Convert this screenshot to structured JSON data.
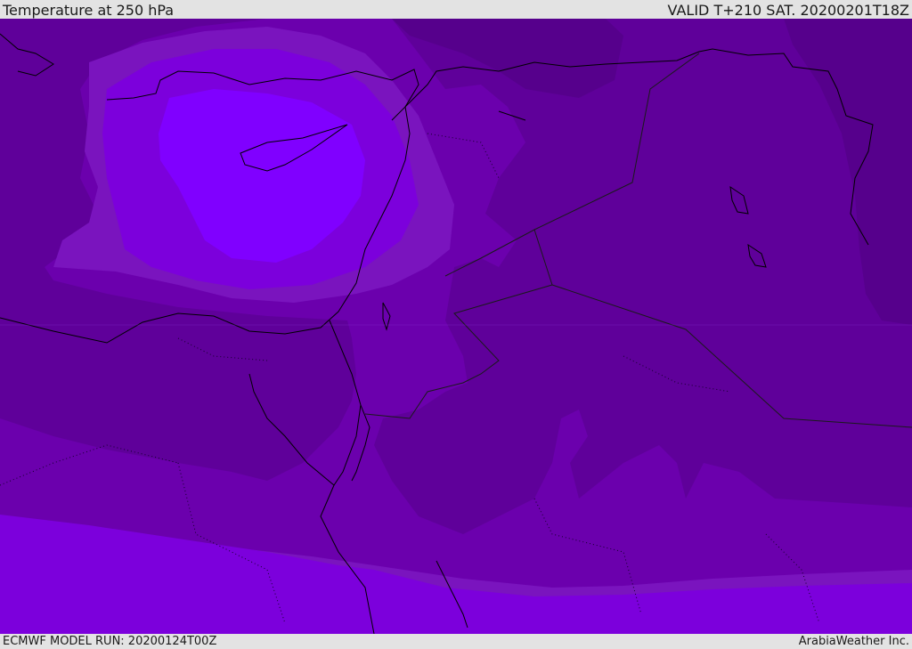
{
  "map": {
    "title": "Temperature at 250 hPa",
    "valid_time": "VALID T+210 SAT. 20200201T18Z",
    "model_run": "ECMWF MODEL RUN: 20200124T00Z",
    "credit": "ArabiaWeather Inc.",
    "colors": {
      "band_coldest_dark": "#56008c",
      "band_dark": "#5f009a",
      "band_mid": "#6b00ad",
      "band_light": "#7a14be",
      "band_bright": "#7c00dc",
      "band_warmest": "#8000ff",
      "coastline": "#000000",
      "borders": "#1a1a1a"
    }
  }
}
